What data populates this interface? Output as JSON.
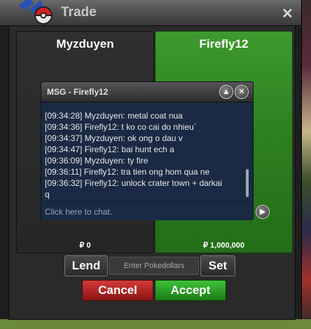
{
  "window": {
    "title": "Trade"
  },
  "trade": {
    "left": {
      "name": "Myzduyen",
      "money": "₽ 0"
    },
    "right": {
      "name": "Firefly12",
      "money": "₽ 1,000,000"
    }
  },
  "chat": {
    "title": "MSG - Firefly12",
    "lines": [
      "[09:34:28] Myzduyen: metal coat nua",
      "[09:34:36] Firefly12: t ko co cai do nhieu`",
      "[09:34:37] Myzduyen: ok ong o dau v",
      "[09:34:47] Firefly12: bai hunt ech a",
      "[09:36:09] Myzduyen: ty fire",
      "[09:36:11] Firefly12: tra tien ong hom qua ne",
      "[09:36:32] Firefly12: unlock crater town + darkai",
      "q"
    ],
    "placeholder": "Click here to chat."
  },
  "controls": {
    "lend_label": "Lend",
    "amount_placeholder": "Enter Pokedollars",
    "set_label": "Set",
    "cancel_label": "Cancel",
    "accept_label": "Accept"
  },
  "icons": {
    "close": "close-icon",
    "minimize": "chevron-up-icon",
    "chat_close": "close-icon",
    "send": "arrow-right-icon",
    "logo": "pokeball-logo-icon"
  },
  "colors": {
    "accept": "#2f9a2a",
    "cancel": "#b12222",
    "selected_panel": "#2f8222"
  }
}
